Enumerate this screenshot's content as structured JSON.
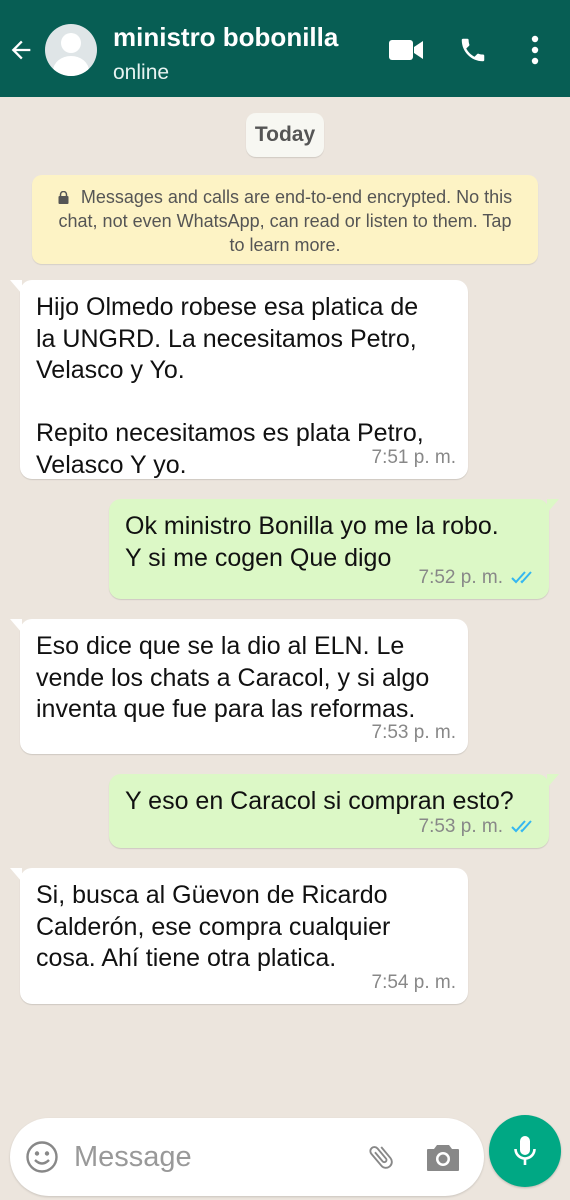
{
  "header": {
    "contact_name": "ministro bobonilla",
    "status": "online"
  },
  "chat": {
    "date_label": "Today",
    "encryption_notice": "Messages and calls are end-to-end encrypted. No this chat, not even WhatsApp, can read or listen to them. Tap to learn more."
  },
  "messages": [
    {
      "direction": "in",
      "text": "Hijo Olmedo robese esa platica de\nla UNGRD. La necesitamos Petro,\nVelasco y Yo.\n\nRepito necesitamos es plata Petro,\nVelasco Y yo.",
      "time": "7:51 p. m."
    },
    {
      "direction": "out",
      "text": "Ok ministro Bonilla yo me la robo.\nY si me cogen Que digo",
      "time": "7:52 p. m.",
      "status": "read"
    },
    {
      "direction": "in",
      "text": "Eso dice que se la dio al ELN. Le\nvende los chats a Caracol, y si algo\ninventa que fue para las reformas.",
      "time": "7:53 p. m."
    },
    {
      "direction": "out",
      "text": "Y eso en Caracol si compran esto?",
      "time": "7:53 p. m.",
      "status": "read"
    },
    {
      "direction": "in",
      "text": "Si, busca al Güevon de Ricardo\nCalderón, ese compra cualquier\ncosa. Ahí tiene otra platica.",
      "time": "7:54 p. m."
    }
  ],
  "composer": {
    "placeholder": "Message"
  },
  "icons": {
    "back": "arrow-left-icon",
    "video": "video-call-icon",
    "call": "phone-icon",
    "menu": "more-vertical-icon",
    "emoji": "emoji-icon",
    "attach": "paperclip-icon",
    "camera": "camera-icon",
    "mic": "microphone-icon",
    "read_ticks": "double-check-icon"
  },
  "colors": {
    "header": "#075e54",
    "outgoing_bubble": "#dcf8c6",
    "incoming_bubble": "#ffffff",
    "encryption_bg": "#fdf3c5",
    "read_ticks": "#34b7f1",
    "mic_button": "#00a884"
  }
}
